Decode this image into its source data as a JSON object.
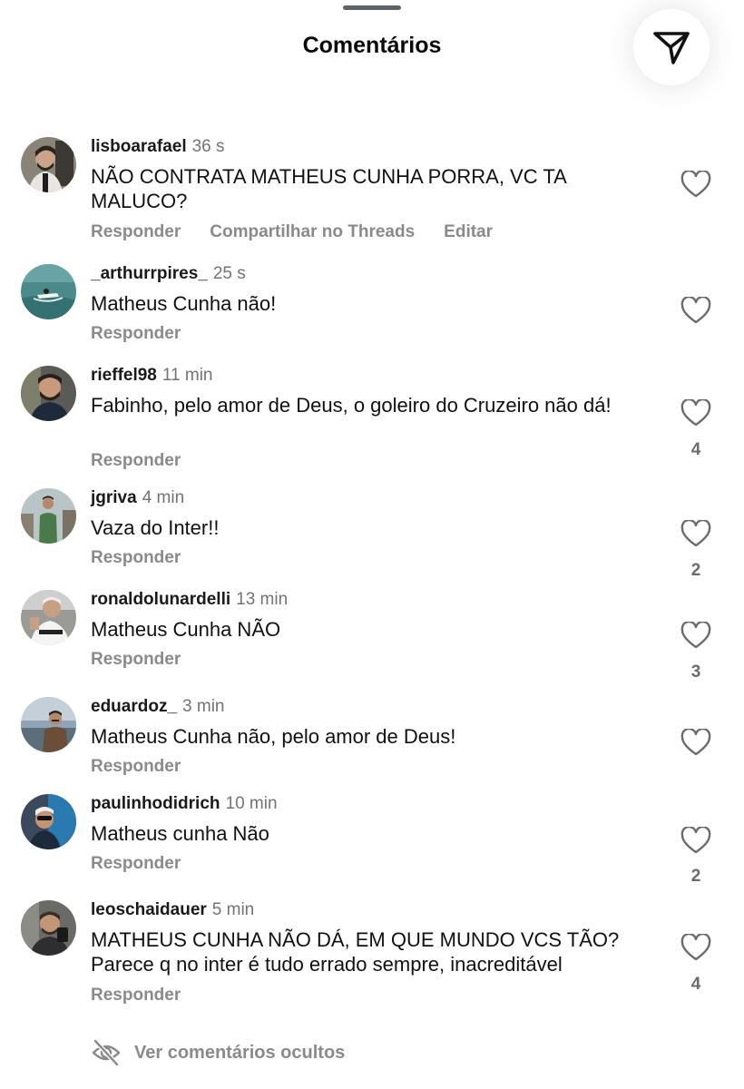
{
  "header": {
    "title": "Comentários",
    "share_icon": "send-icon"
  },
  "comments": [
    {
      "user": "lisboarafael",
      "time": "36 s",
      "text": "NÃO CONTRATA MATHEUS CUNHA PORRA, VC TA MALUCO?",
      "actions": [
        "Responder",
        "Compartilhar no Threads",
        "Editar"
      ],
      "likes": ""
    },
    {
      "user": "_arthurrpires_",
      "time": "25 s",
      "text": "Matheus Cunha não!",
      "actions": [
        "Responder"
      ],
      "likes": ""
    },
    {
      "user": "rieffel98",
      "time": "11 min",
      "text": "Fabinho, pelo amor de Deus, o goleiro do Cruzeiro não dá!",
      "actions": [
        "Responder"
      ],
      "likes": "4"
    },
    {
      "user": "jgriva",
      "time": "4 min",
      "text": "Vaza do Inter!!",
      "actions": [
        "Responder"
      ],
      "likes": "2"
    },
    {
      "user": "ronaldolunardelli",
      "time": "13 min",
      "text": "Matheus Cunha NÃO",
      "actions": [
        "Responder"
      ],
      "likes": "3"
    },
    {
      "user": "eduardoz_",
      "time": "3 min",
      "text": "Matheus Cunha não, pelo amor de Deus!",
      "actions": [
        "Responder"
      ],
      "likes": ""
    },
    {
      "user": "paulinhodidrich",
      "time": "10 min",
      "text": "Matheus cunha Não",
      "actions": [
        "Responder"
      ],
      "likes": "2"
    },
    {
      "user": "leoschaidauer",
      "time": "5 min",
      "text": "MATHEUS CUNHA NÃO DÁ, EM QUE MUNDO VCS TÃO? Parece q no inter é tudo errado sempre, inacreditável",
      "actions": [
        "Responder"
      ],
      "likes": "4"
    }
  ],
  "footer": {
    "hidden_label": "Ver comentários ocultos",
    "hidden_icon": "eye-off-icon"
  },
  "colors": {
    "text": "#111111",
    "muted": "#8a8a8a",
    "time": "#737373"
  }
}
